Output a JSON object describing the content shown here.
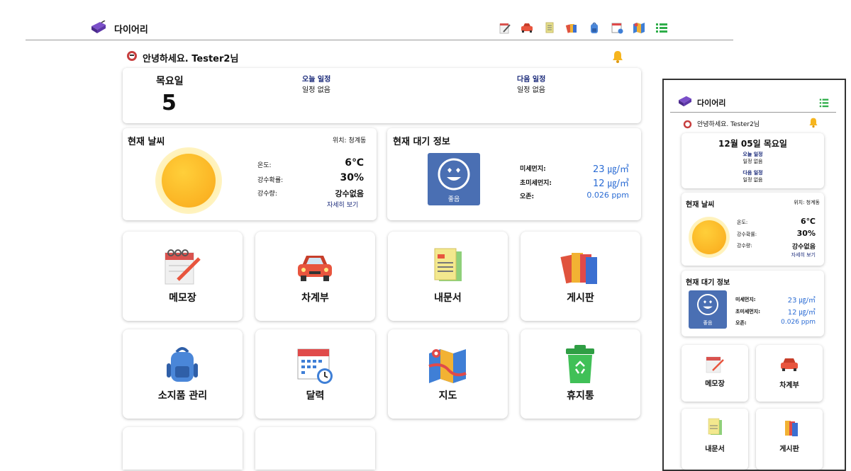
{
  "app": {
    "title": "다이어리"
  },
  "nav": {
    "icons": [
      "notepad-icon",
      "car-icon",
      "document-icon",
      "binder-icon",
      "backpack-icon",
      "calendar-icon",
      "map-icon",
      "list-icon"
    ]
  },
  "greeting": {
    "text": "안녕하세요. Tester2님"
  },
  "schedule": {
    "weekday": "목요일",
    "day": "5",
    "today_title": "오늘 일정",
    "today_value": "일정 없음",
    "next_title": "다음 일정",
    "next_value": "일정 없음"
  },
  "weather": {
    "title": "현재 날씨",
    "location": "위치: 청계동",
    "temp_label": "온도:",
    "temp_value": "6℃",
    "rain_prob_label": "강수확률:",
    "rain_prob_value": "30%",
    "rain_amt_label": "강수량:",
    "rain_amt_value": "강수없음",
    "detail_link": "자세히 보기",
    "icon": "sun-icon"
  },
  "air": {
    "title": "현재 대기 정보",
    "status": "좋음",
    "pm10_label": "미세먼지:",
    "pm10_value": "23 ㎍/㎥",
    "pm25_label": "초미세먼지:",
    "pm25_value": "12 ㎍/㎥",
    "ozone_label": "오존:",
    "ozone_value": "0.026 ppm",
    "icon": "smiley-face-icon",
    "color": "#4a6fb3"
  },
  "tiles": [
    {
      "label": "메모장",
      "icon": "notepad-icon"
    },
    {
      "label": "차계부",
      "icon": "car-icon"
    },
    {
      "label": "내문서",
      "icon": "document-icon"
    },
    {
      "label": "게시판",
      "icon": "binder-icon"
    },
    {
      "label": "소지품 관리",
      "icon": "backpack-icon"
    },
    {
      "label": "달력",
      "icon": "calendar-icon"
    },
    {
      "label": "지도",
      "icon": "map-icon"
    },
    {
      "label": "휴지통",
      "icon": "trash-icon"
    }
  ],
  "mobile": {
    "title": "다이어리",
    "greeting": "안녕하세요. Tester2님",
    "date": "12월 05일 목요일",
    "today_title": "오늘 일정",
    "today_value": "일정 없음",
    "next_title": "다음 일정",
    "next_value": "일정 없음",
    "weather_title": "현재 날씨",
    "location": "위치: 청계동",
    "temp_label": "온도:",
    "temp_value": "6℃",
    "rain_prob_label": "강수확률:",
    "rain_prob_value": "30%",
    "rain_amt_label": "강수량:",
    "rain_amt_value": "강수없음",
    "detail_link": "자세히 보기",
    "air_title": "현재 대기 정보",
    "air_status": "좋음",
    "pm10_label": "미세먼지:",
    "pm10_value": "23 ㎍/㎥",
    "pm25_label": "초미세먼지:",
    "pm25_value": "12 ㎍/㎥",
    "ozone_label": "오존:",
    "ozone_value": "0.026 ppm",
    "tiles": [
      {
        "label": "메모장"
      },
      {
        "label": "차계부"
      },
      {
        "label": "내문서"
      },
      {
        "label": "게시판"
      }
    ]
  },
  "colors": {
    "accent": "#2b6cd4",
    "navy": "#1a2a7a",
    "air_bg": "#4a6fb3",
    "bell": "#f6b51e"
  }
}
